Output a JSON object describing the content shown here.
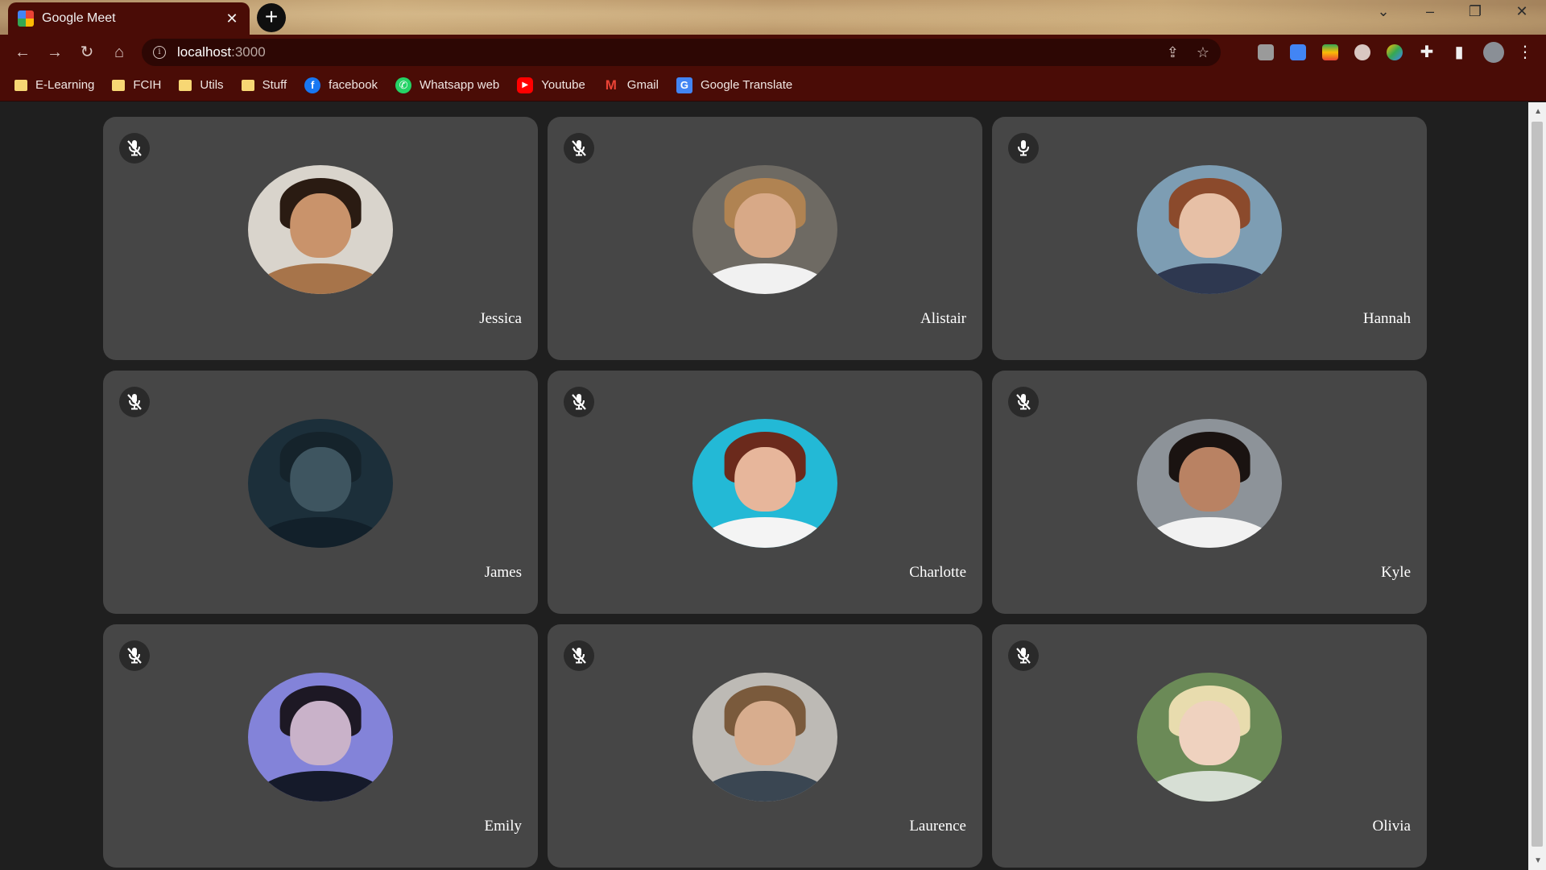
{
  "browser": {
    "tab_title": "Google Meet",
    "tab_close": "✕",
    "new_tab": "+",
    "url_host": "localhost",
    "url_port": ":3000",
    "bookmarks": [
      {
        "label": "E-Learning",
        "icon": "folder-icon"
      },
      {
        "label": "FCIH",
        "icon": "folder-icon"
      },
      {
        "label": "Utils",
        "icon": "folder-icon"
      },
      {
        "label": "Stuff",
        "icon": "folder-icon"
      },
      {
        "label": "facebook",
        "icon": "facebook-icon",
        "color": "#1877f2",
        "glyph": "f"
      },
      {
        "label": "Whatsapp web",
        "icon": "whatsapp-icon",
        "color": "#25d366",
        "glyph": "✆"
      },
      {
        "label": "Youtube",
        "icon": "youtube-icon",
        "color": "#ff0000",
        "glyph": "▶"
      },
      {
        "label": "Gmail",
        "icon": "gmail-icon",
        "color": "#ea4335",
        "glyph": "M"
      },
      {
        "label": "Google Translate",
        "icon": "google-translate-icon",
        "color": "#4285f4",
        "glyph": "G"
      }
    ]
  },
  "participants": [
    {
      "name": "Jessica",
      "mic": "muted",
      "skin": "#c9936b",
      "hair": "#2a1b12",
      "shirt": "#a7744a",
      "bg": "#d9d4cc"
    },
    {
      "name": "Alistair",
      "mic": "muted",
      "skin": "#d8a987",
      "hair": "#b08352",
      "shirt": "#f1f1f1",
      "bg": "#6e6a63"
    },
    {
      "name": "Hannah",
      "mic": "on",
      "skin": "#e7c0a6",
      "hair": "#8b4a2c",
      "shirt": "#2e3850",
      "bg": "#7d9db3"
    },
    {
      "name": "James",
      "mic": "muted",
      "skin": "#3e5560",
      "hair": "#15232b",
      "shirt": "#12202a",
      "bg": "#1c2f3a"
    },
    {
      "name": "Charlotte",
      "mic": "muted",
      "skin": "#e7b69b",
      "hair": "#6b2a1c",
      "shirt": "#f4f4f4",
      "bg": "#23b9d6"
    },
    {
      "name": "Kyle",
      "mic": "muted",
      "skin": "#b98263",
      "hair": "#1a1311",
      "shirt": "#f2f2f2",
      "bg": "#8d9399"
    },
    {
      "name": "Emily",
      "mic": "muted",
      "skin": "#c9b2c9",
      "hair": "#1d1824",
      "shirt": "#151a2a",
      "bg": "#8383d9"
    },
    {
      "name": "Laurence",
      "mic": "muted",
      "skin": "#d8ad8e",
      "hair": "#7a5a3c",
      "shirt": "#3a4652",
      "bg": "#bdbab5"
    },
    {
      "name": "Olivia",
      "mic": "muted",
      "skin": "#efd2bf",
      "hair": "#e8dcae",
      "shirt": "#d7dfd5",
      "bg": "#6b8a57"
    }
  ]
}
